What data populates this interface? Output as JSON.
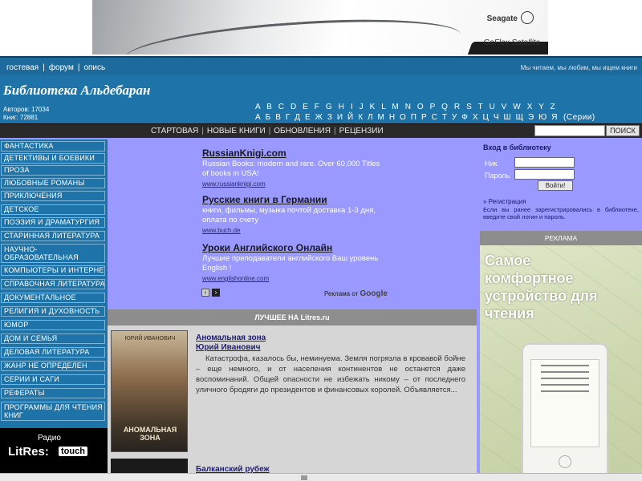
{
  "banner": {
    "brand": "Seagate",
    "product": "GoFlex Satellite"
  },
  "utilbar": {
    "links": [
      "гостевая",
      "форум",
      "опись"
    ],
    "tagline": "Мы читаем, мы любим, мы ищем книги"
  },
  "header": {
    "title": "Библиотека Альдебаран",
    "stats": [
      "Авторов: 17034",
      "Книг: 72881"
    ],
    "alphabet_latin": "A B C D E F G H I J K L M N O P Q R S T U V W X Y Z",
    "alphabet_cyr": "А Б В Г Д Е Ж З И Й К Л М Н О П Р С Т У Ф Х Ц Ч Ш Щ Э Ю Я",
    "series_link": "(Серии)"
  },
  "navbar": {
    "items": [
      "СТАРТОВАЯ",
      "НОВЫЕ КНИГИ",
      "ОБНОВЛЕНИЯ",
      "РЕЦЕНЗИИ"
    ],
    "search_button": "ПОИСК"
  },
  "sidebar": {
    "categories": [
      "Фантастика",
      "Детективы и боевики",
      "Проза",
      "Любовные романы",
      "Приключения",
      "Детское",
      "Поэзия и драматургия",
      "Старинная литература",
      "Научно-образовательная",
      "Компьютеры и интернет",
      "Справочная литература",
      "Документальное",
      "Религия и духовность",
      "Юмор",
      "Дом и семья",
      "Деловая литература",
      "Жанр не определен",
      "Серии и саги",
      "Рефераты",
      "Программы для чтения книг"
    ],
    "radio_label": "Радио",
    "litres_logo": "LitRes:",
    "touch_badge": "touch"
  },
  "ads": {
    "items": [
      {
        "title": "RussianKnigi.com",
        "text": "Russian Books: modern and rare. Over 60,000 Titles of books in USA!",
        "url": "www.russianknigi.com"
      },
      {
        "title": "Русские книги в Германии",
        "text": "книги, фильмы, музыка почтой доставка 1-3 дня, оплата по счету",
        "url": "www.buch.de"
      },
      {
        "title": "Уроки Английского Онлайн",
        "text": "Лучшие преподаватели английского Ваш уровень English !",
        "url": "www.englishonline.com"
      }
    ],
    "prev_icon": "‹",
    "next_icon": "›",
    "ads_by_prefix": "Реклама от",
    "ads_by_brand": "Google"
  },
  "best": {
    "header": "ЛУЧШЕЕ НА Litres.ru",
    "book_title": "Аномальная зона",
    "book_author": "Юрий Иванович",
    "cover_title": "АНОМАЛЬНАЯ ЗОНА",
    "cover_author": "ЮРИЙ ИВАНОВИЧ",
    "description": "Катастрофа, казалось бы, неминуема. Земля погрязла в кровавой бойне – еще немного, и от населения континентов не останется даже воспоминаний. Общей опасности не избежать никому – от последнего уличного бродяги до президентов и финансовых королей. Объявляется...",
    "book2_title": "Балканский рубеж"
  },
  "login": {
    "title": "Вход в библиотеку",
    "login_label": "Ник",
    "password_label": "Пароль",
    "button": "Войти!",
    "register_link": "» Регистрация",
    "note": "Если вы ранее зарегистрировались в библиотеке, введите свой логин и пароль."
  },
  "right_ad": {
    "header": "РЕКЛАМА",
    "slogan": "Самое комфортное устройство для чтения"
  }
}
